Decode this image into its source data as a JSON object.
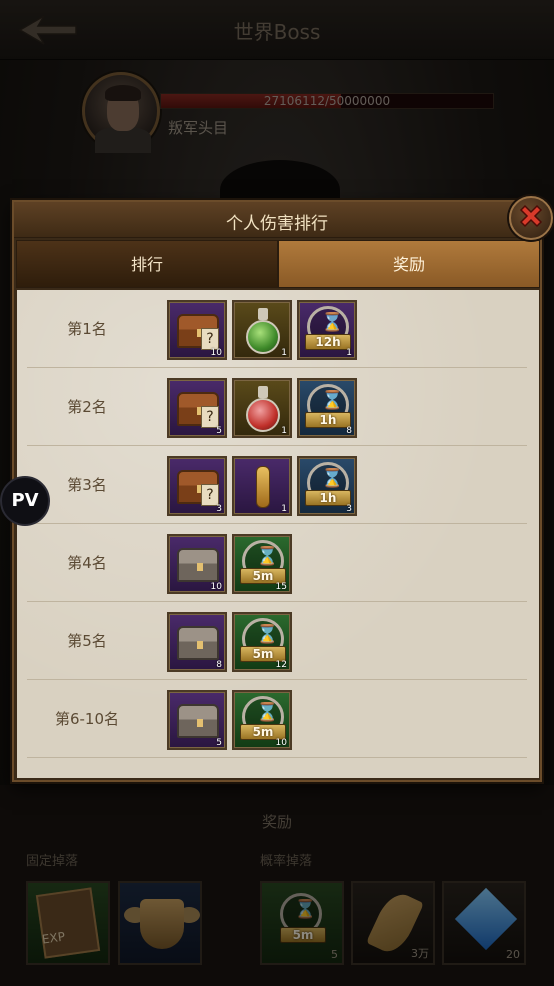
{
  "topbar": {
    "title": "世界Boss"
  },
  "boss": {
    "hp_text": "27106112/50000000",
    "hp_fraction": 0.542,
    "name": "叛军头目"
  },
  "modal": {
    "title": "个人伤害排行",
    "tabs": [
      {
        "label": "排行",
        "active": false
      },
      {
        "label": "奖励",
        "active": true
      }
    ],
    "rows": [
      {
        "rank": "第1名",
        "items": [
          {
            "icon": "mystery-chest-icon",
            "bg": "purple",
            "count": "10"
          },
          {
            "icon": "green-potion-icon",
            "bg": "brown",
            "count": "1"
          },
          {
            "icon": "speedup-hourglass-icon",
            "bg": "purple",
            "time": "12h",
            "count": "1"
          }
        ]
      },
      {
        "rank": "第2名",
        "items": [
          {
            "icon": "mystery-chest-icon",
            "bg": "purple",
            "count": "5"
          },
          {
            "icon": "red-potion-icon",
            "bg": "brown",
            "count": "1"
          },
          {
            "icon": "speedup-hourglass-icon",
            "bg": "blue",
            "time": "1h",
            "count": "8"
          }
        ]
      },
      {
        "rank": "第3名",
        "items": [
          {
            "icon": "mystery-chest-icon",
            "bg": "purple",
            "count": "3"
          },
          {
            "icon": "vial-icon",
            "bg": "purple",
            "count": "1"
          },
          {
            "icon": "speedup-hourglass-icon",
            "bg": "blue",
            "time": "1h",
            "count": "3"
          }
        ]
      },
      {
        "rank": "第4名",
        "items": [
          {
            "icon": "silver-chest-icon",
            "bg": "purple",
            "count": "10"
          },
          {
            "icon": "speedup-hourglass-icon",
            "bg": "green",
            "time": "5m",
            "count": "15"
          }
        ]
      },
      {
        "rank": "第5名",
        "items": [
          {
            "icon": "silver-chest-icon",
            "bg": "purple",
            "count": "8"
          },
          {
            "icon": "speedup-hourglass-icon",
            "bg": "green",
            "time": "5m",
            "count": "12"
          }
        ]
      },
      {
        "rank": "第6-10名",
        "items": [
          {
            "icon": "silver-chest-icon",
            "bg": "purple",
            "count": "5"
          },
          {
            "icon": "speedup-hourglass-icon",
            "bg": "green",
            "time": "5m",
            "count": "10"
          }
        ]
      }
    ]
  },
  "pv_label": "PV",
  "lower": {
    "heading": "奖励",
    "fixed_drop_label": "固定掉落",
    "chance_drop_label": "概率掉落",
    "fixed_drops": [
      {
        "icon": "exp-book-icon",
        "label": "EXP"
      },
      {
        "icon": "winged-badge-icon"
      }
    ],
    "chance_drops": [
      {
        "icon": "speedup-hourglass-icon",
        "time": "5m",
        "count": "5"
      },
      {
        "icon": "wheat-icon",
        "count": "3万"
      },
      {
        "icon": "diamond-icon",
        "count": "20"
      }
    ]
  }
}
